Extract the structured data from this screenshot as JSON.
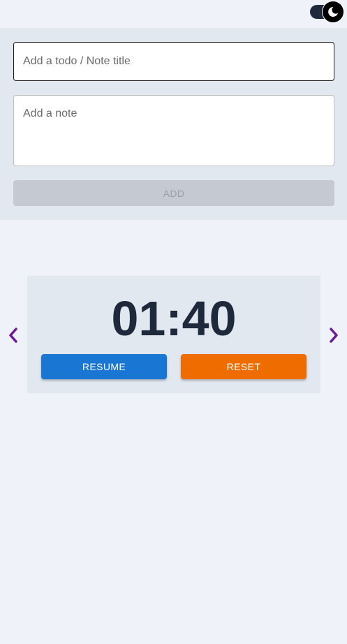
{
  "theme_toggle": {
    "icon": "moon-icon",
    "track_color": "#1e293b"
  },
  "form": {
    "title_placeholder": "Add a todo / Note title",
    "note_placeholder": "Add a note",
    "add_label": "ADD"
  },
  "timer": {
    "display": "01:40",
    "resume_label": "RESUME",
    "reset_label": "RESET",
    "resume_color": "#1976d2",
    "reset_color": "#ef6c00"
  },
  "carousel": {
    "prev_icon": "chevron-left-icon",
    "next_icon": "chevron-right-icon",
    "arrow_color": "#6a1b9a"
  }
}
